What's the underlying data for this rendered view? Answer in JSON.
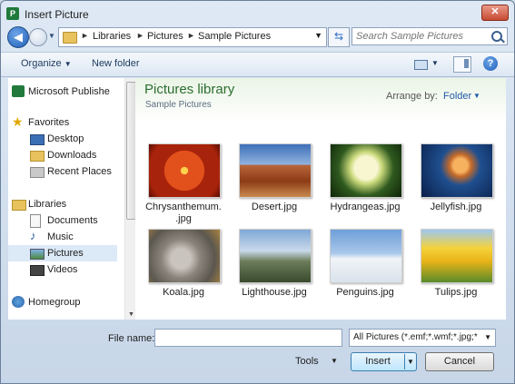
{
  "window": {
    "title": "Insert Picture",
    "app_icon": "P"
  },
  "navigation": {
    "breadcrumbs": [
      "Libraries",
      "Pictures",
      "Sample Pictures"
    ],
    "search_placeholder": "Search Sample Pictures"
  },
  "toolbar": {
    "organize_label": "Organize",
    "new_folder_label": "New folder",
    "help_label": "?"
  },
  "sidebar": {
    "items": [
      {
        "label": "Microsoft Publishe",
        "icon": "publisher-icon"
      },
      {
        "label": "Favorites",
        "icon": "star-icon"
      },
      {
        "label": "Desktop",
        "icon": "desktop-icon"
      },
      {
        "label": "Downloads",
        "icon": "downloads-icon"
      },
      {
        "label": "Recent Places",
        "icon": "recent-places-icon"
      },
      {
        "label": "Libraries",
        "icon": "libraries-icon"
      },
      {
        "label": "Documents",
        "icon": "documents-icon"
      },
      {
        "label": "Music",
        "icon": "music-icon"
      },
      {
        "label": "Pictures",
        "icon": "pictures-icon",
        "selected": true
      },
      {
        "label": "Videos",
        "icon": "videos-icon"
      },
      {
        "label": "Homegroup",
        "icon": "homegroup-icon"
      }
    ]
  },
  "library": {
    "title": "Pictures library",
    "subtitle": "Sample Pictures",
    "arrange_label": "Arrange by:",
    "arrange_value": "Folder"
  },
  "files": [
    {
      "name": "Chrysanthemum.",
      "name2": ".jpg"
    },
    {
      "name": "Desert.jpg",
      "name2": ""
    },
    {
      "name": "Hydrangeas.jpg",
      "name2": ""
    },
    {
      "name": "Jellyfish.jpg",
      "name2": ""
    },
    {
      "name": "Koala.jpg",
      "name2": ""
    },
    {
      "name": "Lighthouse.jpg",
      "name2": ""
    },
    {
      "name": "Penguins.jpg",
      "name2": ""
    },
    {
      "name": "Tulips.jpg",
      "name2": ""
    }
  ],
  "footer": {
    "file_name_label": "File name:",
    "file_name_value": "",
    "filter_value": "All Pictures (*.emf;*.wmf;*.jpg;*",
    "tools_label": "Tools",
    "insert_label": "Insert",
    "cancel_label": "Cancel"
  },
  "colors": {
    "accent": "#2c6e2f",
    "link": "#1f5aa8",
    "selection": "#dce9f7"
  }
}
